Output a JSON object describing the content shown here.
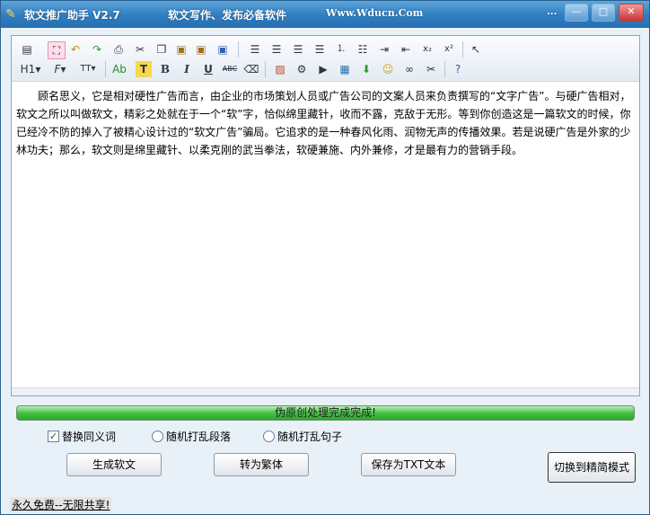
{
  "window": {
    "title": "软文推广助手 V2.7",
    "subtitle": "软文写作、发布必备软件",
    "website": "Www.Wducn.Com",
    "ellipsis": "...",
    "btn_min": "—",
    "btn_max": "□",
    "btn_close": "✕"
  },
  "toolbar": {
    "row1": [
      "source-icon",
      "fullscreen-icon",
      "undo-icon",
      "redo-icon",
      "print-icon",
      "cut-icon",
      "copy-icon",
      "paste-icon",
      "paste-text-icon",
      "paste-word-icon",
      "align-left-icon",
      "align-center-icon",
      "align-right-icon",
      "align-justify-icon",
      "ordered-list-icon",
      "unordered-list-icon",
      "indent-icon",
      "outdent-icon",
      "subscript-icon",
      "superscript-icon",
      "select-icon"
    ],
    "heading_label": "H1",
    "font_label": "F",
    "size_label": "TT",
    "forecolor_label": "Ab",
    "backcolor_label": "T",
    "bold_label": "B",
    "italic_label": "I",
    "underline_label": "U",
    "strike_label": "ABC"
  },
  "content": {
    "text": "顾名思义，它是相对硬性广告而言，由企业的市场策划人员或广告公司的文案人员来负责撰写的“文字广告”。与硬广告相对，软文之所以叫做软文，精彩之处就在于一个“软”字，恰似绵里藏针，收而不露，克敌于无形。等到你创造这是一篇软文的时候，你已经冷不防的掉入了被精心设计过的“软文广告”骗局。它追求的是一种春风化雨、润物无声的传播效果。若是说硬广告是外家的少林功夫；那么，软文则是绵里藏针、以柔克刚的武当拳法，软硬兼施、内外兼修，才是最有力的营销手段。"
  },
  "progress": {
    "label": "伪原创处理完成完成!",
    "value": 1.0
  },
  "options": {
    "synonym": {
      "label": "替换同义词",
      "checked": true
    },
    "shuffle_para": {
      "label": "随机打乱段落",
      "checked": false
    },
    "shuffle_sentence": {
      "label": "随机打乱句子",
      "checked": false
    }
  },
  "buttons": {
    "generate": "生成软文",
    "traditional": "转为繁体",
    "save_txt": "保存为TXT文本",
    "simple_mode": "切换到精简模式"
  },
  "status": {
    "text": "永久免费--无限共享!"
  }
}
